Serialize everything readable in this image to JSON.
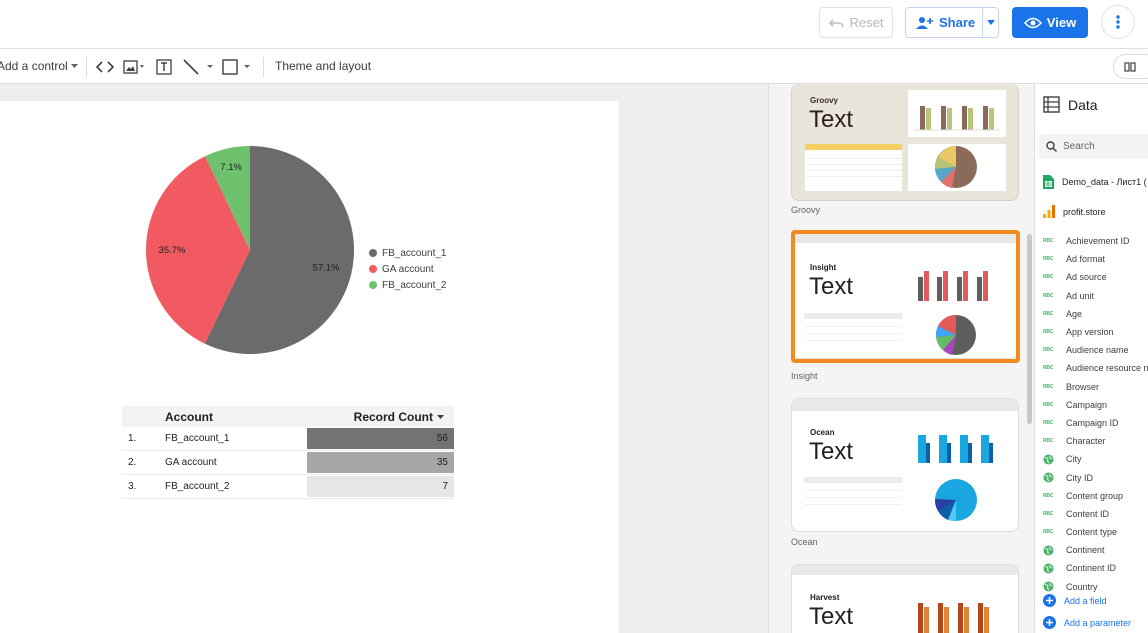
{
  "header": {
    "reset_label": "Reset",
    "share_label": "Share",
    "view_label": "View",
    "brand_color": "#1a73e8"
  },
  "toolbar": {
    "add_control_label": "Add a control",
    "theme_layout_label": "Theme and layout"
  },
  "chart_data": [
    {
      "type": "pie",
      "categories": [
        "FB_account_1",
        "GA account",
        "FB_account_2"
      ],
      "values": [
        57.1,
        35.7,
        7.1
      ],
      "labels": [
        "57.1%",
        "35.7%",
        "7.1%"
      ],
      "colors": [
        "#6b6b6b",
        "#f15a60",
        "#6ec26e"
      ],
      "legend_position": "right"
    },
    {
      "type": "table",
      "columns": [
        "Account",
        "Record Count"
      ],
      "rows": [
        {
          "index": "1.",
          "account": "FB_account_1",
          "count": 56
        },
        {
          "index": "2.",
          "account": "GA account",
          "count": 35
        },
        {
          "index": "3.",
          "account": "FB_account_2",
          "count": 7
        }
      ],
      "bar_colors": [
        "#737373",
        "#a6a6a6",
        "#e6e6e6"
      ],
      "max": 56
    }
  ],
  "themes": [
    {
      "name": "Groovy",
      "title_small": "Groovy",
      "title_big": "Text",
      "bg": "#e9e5da",
      "bar_colors": [
        "#8a6a58",
        "#b7c47a"
      ],
      "pie_colors": [
        "#8a6a58",
        "#e9c868",
        "#b7c47a",
        "#55a8c8",
        "#e06f6f"
      ]
    },
    {
      "name": "Insight",
      "title_small": "Insight",
      "title_big": "Text",
      "bg": "#ffffff",
      "bar_colors": [
        "#5e5e5e",
        "#e35a5a"
      ],
      "pie_colors": [
        "#5e5e5e",
        "#e35a5a",
        "#42a5f5",
        "#66bb6a",
        "#ab47bc"
      ]
    },
    {
      "name": "Ocean",
      "title_small": "Ocean",
      "title_big": "Text",
      "bg": "#ffffff",
      "bar_colors": [
        "#1aa7e0",
        "#0d5fa8"
      ],
      "pie_colors": [
        "#1aa7e0",
        "#0d5fa8",
        "#2b3ea8",
        "#52c7f0"
      ]
    },
    {
      "name": "Harvest",
      "title_small": "Harvest",
      "title_big": "Text",
      "bg": "#ffffff",
      "bar_colors": [
        "#b8441c",
        "#e0863a"
      ],
      "pie_colors": []
    }
  ],
  "data_panel": {
    "title": "Data",
    "search_placeholder": "Search",
    "sources": [
      "Demo_data - Лист1 (",
      "profit.store"
    ],
    "fields": [
      {
        "type": "text",
        "name": "Achievement ID"
      },
      {
        "type": "text",
        "name": "Ad format"
      },
      {
        "type": "text",
        "name": "Ad source"
      },
      {
        "type": "text",
        "name": "Ad unit"
      },
      {
        "type": "text",
        "name": "Age"
      },
      {
        "type": "text",
        "name": "App version"
      },
      {
        "type": "text",
        "name": "Audience name"
      },
      {
        "type": "text",
        "name": "Audience resource n"
      },
      {
        "type": "text",
        "name": "Browser"
      },
      {
        "type": "text",
        "name": "Campaign"
      },
      {
        "type": "text",
        "name": "Campaign ID"
      },
      {
        "type": "text",
        "name": "Character"
      },
      {
        "type": "geo",
        "name": "City"
      },
      {
        "type": "geo",
        "name": "City ID"
      },
      {
        "type": "text",
        "name": "Content group"
      },
      {
        "type": "text",
        "name": "Content ID"
      },
      {
        "type": "text",
        "name": "Content type"
      },
      {
        "type": "geo",
        "name": "Continent"
      },
      {
        "type": "geo",
        "name": "Continent ID"
      },
      {
        "type": "geo",
        "name": "Country"
      }
    ],
    "type_badge": "RBC",
    "add_field_label": "Add a field",
    "add_parameter_label": "Add a parameter"
  }
}
